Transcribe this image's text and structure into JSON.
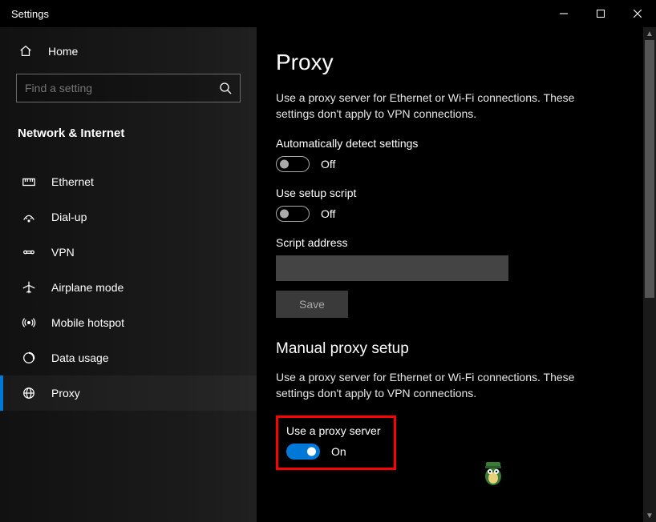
{
  "window": {
    "title": "Settings"
  },
  "sidebar": {
    "home_label": "Home",
    "search_placeholder": "Find a setting",
    "category_label": "Network & Internet",
    "items": [
      {
        "icon": "ethernet-icon",
        "label": "Ethernet"
      },
      {
        "icon": "dialup-icon",
        "label": "Dial-up"
      },
      {
        "icon": "vpn-icon",
        "label": "VPN"
      },
      {
        "icon": "airplane-icon",
        "label": "Airplane mode"
      },
      {
        "icon": "hotspot-icon",
        "label": "Mobile hotspot"
      },
      {
        "icon": "datausage-icon",
        "label": "Data usage"
      },
      {
        "icon": "proxy-icon",
        "label": "Proxy"
      }
    ]
  },
  "main": {
    "title": "Proxy",
    "description1": "Use a proxy server for Ethernet or Wi-Fi connections. These settings don't apply to VPN connections.",
    "auto_detect_label": "Automatically detect settings",
    "auto_detect_state": "Off",
    "use_script_label": "Use setup script",
    "use_script_state": "Off",
    "script_address_label": "Script address",
    "script_address_value": "",
    "save_label": "Save",
    "manual_section_title": "Manual proxy setup",
    "description2": "Use a proxy server for Ethernet or Wi-Fi connections. These settings don't apply to VPN connections.",
    "use_proxy_label": "Use a proxy server",
    "use_proxy_state": "On"
  }
}
